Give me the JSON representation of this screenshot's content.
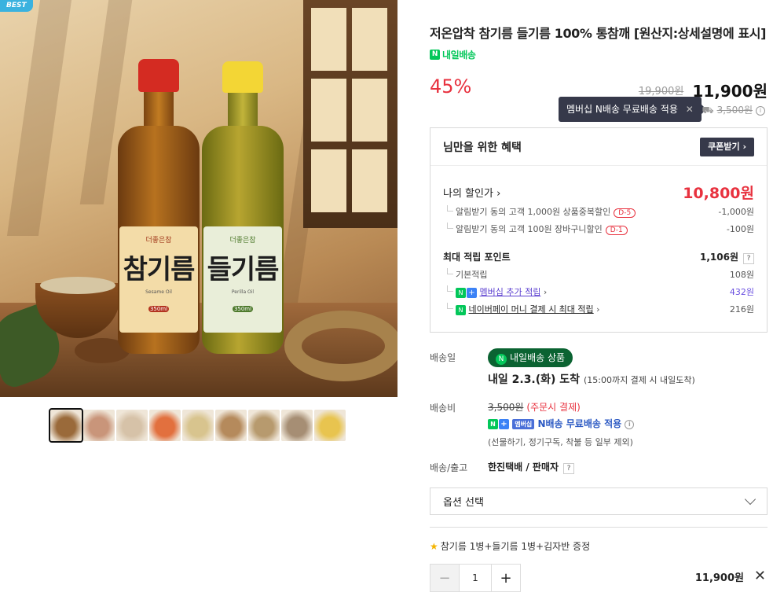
{
  "gallery": {
    "best_badge": "BEST",
    "product_label_brand": "더좋은참",
    "bottle1_text": "참기름",
    "bottle1_sub": "Sesame Oil",
    "bottle1_volume": "350ml",
    "bottle2_text": "들기름",
    "bottle2_sub": "Perilla Oil",
    "bottle2_volume": "350ml",
    "thumbnail_colors": [
      "#9a6a3a",
      "#c9957a",
      "#d6c2a8",
      "#e2703e",
      "#d8c48e",
      "#b58a5c",
      "#b79a6e",
      "#a68e74",
      "#e8c44f"
    ]
  },
  "product": {
    "title": "저온압착 참기름 들기름 100% 통참깨 [원산지:상세설명에 표시]",
    "delivery_badge": "내일배송",
    "discount": "45%",
    "original_price": "19,900원",
    "price": "11,900원"
  },
  "tooltip": {
    "text": "멤버십 N배송 무료배송 적용"
  },
  "shipping_fee_top": "3,500원",
  "benefit": {
    "title": "님만을 위한 혜택",
    "coupon_button": "쿠폰받기",
    "my_discount_label": "나의 할인가",
    "my_discount_value": "10,800원",
    "sub1_label": "알림받기 동의 고객 1,000원 상품중복할인",
    "sub1_tag": "D-5",
    "sub1_value": "-1,000원",
    "sub2_label": "알림받기 동의 고객 100원 장바구니할인",
    "sub2_tag": "D-1",
    "sub2_value": "-100원",
    "max_point_label": "최대 적립 포인트",
    "max_point_value": "1,106원",
    "base_label": "기본적립",
    "base_value": "108원",
    "member_label": "멤버십 추가 적립",
    "member_value": "432원",
    "npay_label": "네이버페이 머니 결제 시 최대 적립",
    "npay_value": "216원"
  },
  "shipping": {
    "date_label": "배송일",
    "badge": "내일배송 상품",
    "arrive": "내일 2.3.(화) 도착",
    "arrive_note": "(15:00까지 결제 시 내일도착)",
    "fee_label": "배송비",
    "fee": "3,500원",
    "fee_note": "(주문시 결제)",
    "member_tag": "멤버십",
    "member_text": "N배송 무료배송 적용",
    "exception": "(선물하기, 정기구독, 착불 등 일부 제외)",
    "courier_label": "배송/출고",
    "courier": "한진택배 / 판매자"
  },
  "option": {
    "select_label": "옵션 선택"
  },
  "gift": {
    "text": "참기름 1병+들기름 1병+김자반 증정"
  },
  "cart": {
    "quantity": "1",
    "total": "11,900원"
  }
}
